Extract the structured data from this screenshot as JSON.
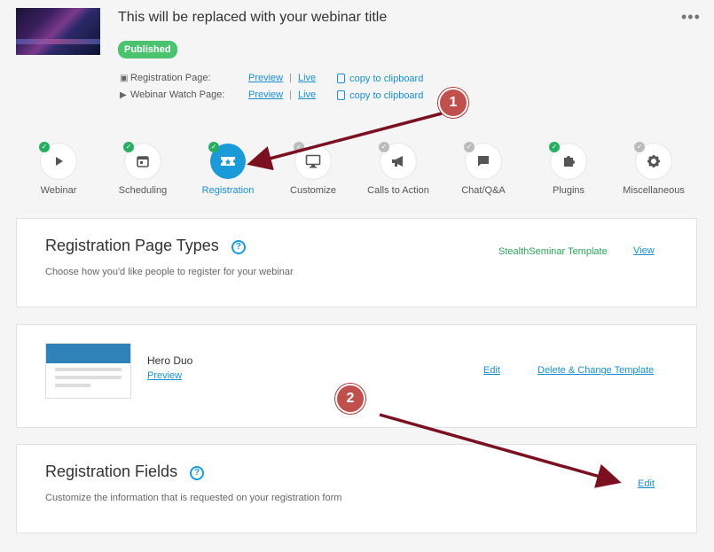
{
  "header": {
    "title": "This will be replaced with your webinar title",
    "status": "Published",
    "more": "•••",
    "links": [
      {
        "label": "Registration Page:",
        "preview": "Preview",
        "sep": "|",
        "live": "Live",
        "copy": "copy to clipboard",
        "icon": "ticket-icon"
      },
      {
        "label": "Webinar Watch Page:",
        "preview": "Preview",
        "sep": "|",
        "live": "Live",
        "copy": "copy to clipboard",
        "icon": "play-icon"
      }
    ]
  },
  "steps": [
    {
      "label": "Webinar",
      "icon": "play-icon",
      "done": true
    },
    {
      "label": "Scheduling",
      "icon": "calendar-icon",
      "done": true
    },
    {
      "label": "Registration",
      "icon": "ticket-icon",
      "done": true,
      "active": true
    },
    {
      "label": "Customize",
      "icon": "monitor-icon",
      "done": false
    },
    {
      "label": "Calls to Action",
      "icon": "megaphone-icon",
      "done": false
    },
    {
      "label": "Chat/Q&A",
      "icon": "chat-icon",
      "done": false
    },
    {
      "label": "Plugins",
      "icon": "puzzle-icon",
      "done": true
    },
    {
      "label": "Miscellaneous",
      "icon": "gear-icon",
      "done": false
    }
  ],
  "registration_types": {
    "title": "Registration Page Types",
    "description": "Choose how you'd like people to register for your webinar",
    "template_name": "StealthSeminar Template",
    "view_label": "View"
  },
  "template_card": {
    "name": "Hero Duo",
    "preview_label": "Preview",
    "edit_label": "Edit",
    "delete_label": "Delete & Change Template"
  },
  "registration_fields": {
    "title": "Registration Fields",
    "description": "Customize the information that is requested on your registration form",
    "edit_label": "Edit"
  },
  "annotations": [
    {
      "label": "1"
    },
    {
      "label": "2"
    }
  ],
  "colors": {
    "accent": "#1a9ad8",
    "success": "#4bc26e",
    "annotation": "#c0504d",
    "arrow": "#7a1020"
  }
}
